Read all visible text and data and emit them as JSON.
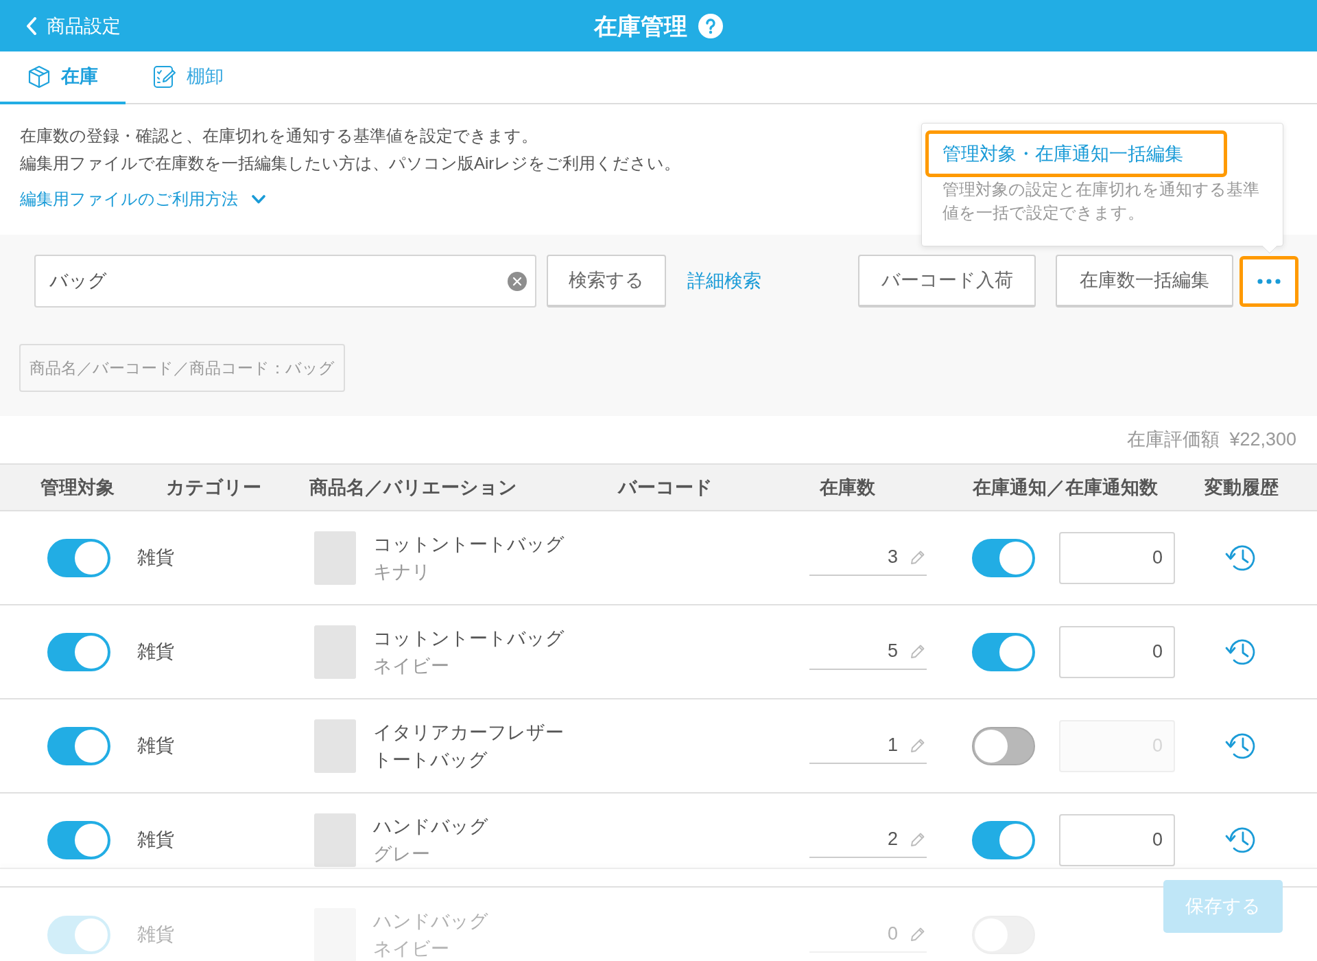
{
  "header": {
    "back_label": "商品設定",
    "title": "在庫管理"
  },
  "tabs": [
    {
      "label": "在庫",
      "kind": "box",
      "selected": true
    },
    {
      "label": "棚卸",
      "kind": "checklist",
      "selected": false
    }
  ],
  "description": {
    "lines": [
      "在庫数の登録・確認と、在庫切れを通知する基準値を設定できます。",
      "編集用ファイルで在庫数を一括編集したい方は、パソコン版Airレジをご利用ください。"
    ],
    "help_link": "編集用ファイルのご利用方法",
    "expanded": false
  },
  "popover": {
    "items": [
      {
        "label": "管理対象・在庫通知一括編集",
        "description": "管理対象の設定と在庫切れを通知する基準値を一括で設定できます。",
        "highlighted": true
      }
    ]
  },
  "search": {
    "value": "バッグ",
    "button": "検索する",
    "advanced_link": "詳細検索"
  },
  "actions": {
    "buttons": [
      "バーコード入荷",
      "在庫数一括編集"
    ],
    "more": {
      "highlighted": true
    }
  },
  "filter_chips": [
    "商品名／バーコード／商品コード：バッグ"
  ],
  "inventory_value": {
    "label": "在庫評価額",
    "amount": "¥22,300"
  },
  "table": {
    "columns": [
      "管理対象",
      "カテゴリー",
      "商品名／バリエーション",
      "バーコード",
      "在庫数",
      "在庫通知／在庫通知数",
      "変動履歴"
    ],
    "rows": [
      {
        "managed": true,
        "category": "雑貨",
        "name": "コットントートバッグ",
        "variation": "キナリ",
        "stock": "3",
        "notify": true,
        "threshold": "0",
        "faded": false
      },
      {
        "managed": true,
        "category": "雑貨",
        "name": "コットントートバッグ",
        "variation": "ネイビー",
        "stock": "5",
        "notify": true,
        "threshold": "0",
        "faded": false
      },
      {
        "managed": true,
        "category": "雑貨",
        "name": "イタリアカーフレザートートバッグ",
        "stock": "1",
        "notify": false,
        "threshold": "0",
        "faded": false
      },
      {
        "managed": true,
        "category": "雑貨",
        "name": "ハンドバッグ",
        "variation": "グレー",
        "stock": "2",
        "notify": true,
        "threshold": "0",
        "faded": false
      },
      {
        "managed": true,
        "category": "雑貨",
        "name": "ハンドバッグ",
        "variation": "ネイビー",
        "stock": "0",
        "notify": false,
        "faded": true
      }
    ]
  },
  "save_button": {
    "label": "保存する",
    "disabled": true
  }
}
